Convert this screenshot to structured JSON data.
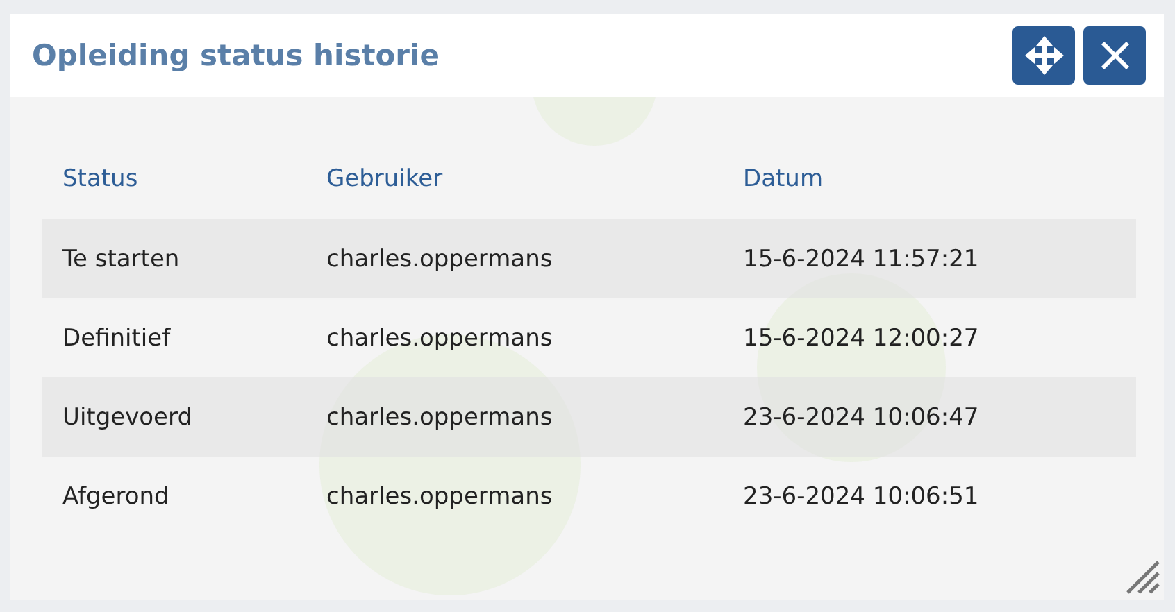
{
  "dialog": {
    "title": "Opleiding status historie"
  },
  "table": {
    "columns": [
      "Status",
      "Gebruiker",
      "Datum"
    ],
    "rows": [
      {
        "cells": [
          "Te starten",
          "charles.oppermans",
          "15-6-2024 11:57:21"
        ]
      },
      {
        "cells": [
          "Definitief",
          "charles.oppermans",
          "15-6-2024 12:00:27"
        ]
      },
      {
        "cells": [
          "Uitgevoerd",
          "charles.oppermans",
          "23-6-2024 10:06:47"
        ]
      },
      {
        "cells": [
          "Afgerond",
          "charles.oppermans",
          "23-6-2024 10:06:51"
        ]
      }
    ]
  }
}
